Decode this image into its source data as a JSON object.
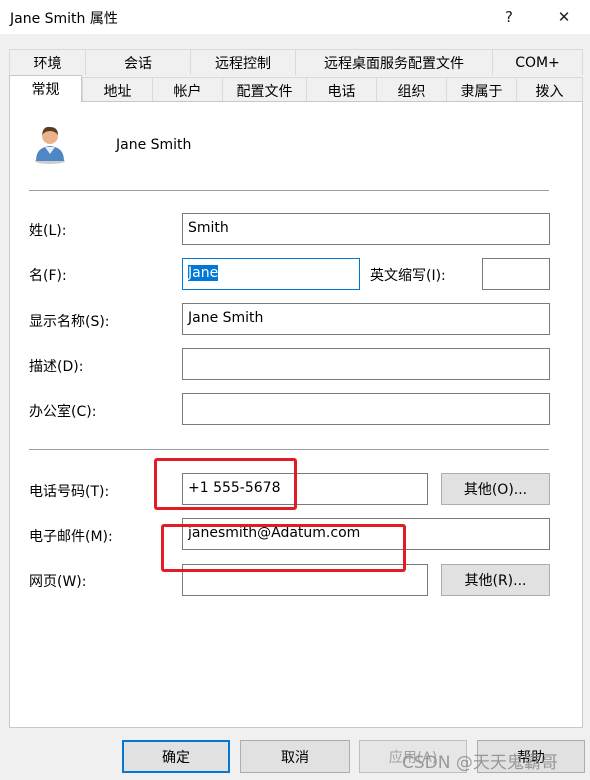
{
  "window": {
    "title": "Jane Smith 属性",
    "help_glyph": "?",
    "close_glyph": "✕"
  },
  "tabs_back": [
    "环境",
    "会话",
    "远程控制",
    "远程桌面服务配置文件",
    "COM+"
  ],
  "tabs_front": [
    "常规",
    "地址",
    "帐户",
    "配置文件",
    "电话",
    "组织",
    "隶属于",
    "拨入"
  ],
  "active_tab": "常规",
  "user": {
    "display_name": "Jane Smith",
    "icon": "user-avatar-icon"
  },
  "form": {
    "last_name_label": "姓(L):",
    "last_name_value": "Smith",
    "first_name_label": "名(F):",
    "first_name_value": "Jane",
    "initials_label": "英文缩写(I):",
    "initials_value": "",
    "display_label": "显示名称(S):",
    "display_value": "Jane Smith",
    "desc_label": "描述(D):",
    "desc_value": "",
    "office_label": "办公室(C):",
    "office_value": "",
    "phone_label": "电话号码(T):",
    "phone_value": "+1 555-5678",
    "phone_other": "其他(O)...",
    "email_label": "电子邮件(M):",
    "email_value": "janesmith@Adatum.com",
    "web_label": "网页(W):",
    "web_value": "",
    "web_other": "其他(R)..."
  },
  "buttons": {
    "ok": "确定",
    "cancel": "取消",
    "apply": "应用(A)",
    "help": "帮助"
  },
  "watermark": "CSDN @天天鬼霸哥",
  "colors": {
    "highlight": "#e21b25",
    "focus": "#0078d7"
  }
}
